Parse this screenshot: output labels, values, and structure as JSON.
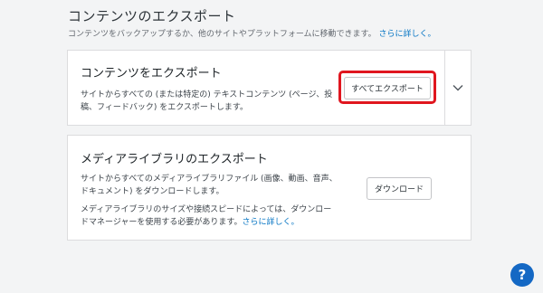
{
  "header": {
    "title": "コンテンツのエクスポート",
    "description": "コンテンツをバックアップするか、他のサイトやプラットフォームに移動できます。",
    "learn_more": "さらに詳しく。"
  },
  "export_card": {
    "title": "コンテンツをエクスポート",
    "description_line1": "サイトからすべての (または特定の) テキストコンテンツ (ページ、投",
    "description_line2": "稿、フィードバック) をエクスポートします。",
    "button_label": "すべてエクスポート",
    "toggle_icon": "chevron-down-icon"
  },
  "media_card": {
    "title": "メディアライブラリのエクスポート",
    "description_line1": "サイトからすべてのメディアライブラリファイル (画像、動画、音声、",
    "description_line2": "ドキュメント) をダウンロードします。",
    "note_line1": "メディアライブラリのサイズや接続スピードによっては、ダウンロー",
    "note_line2": "ドマネージャーを使用する必要があります。",
    "learn_more": "さらに詳しく。",
    "button_label": "ダウンロード"
  },
  "help": {
    "label": "?",
    "icon": "help-icon"
  },
  "colors": {
    "link": "#0675c4",
    "highlight": "#e0161f",
    "help_button": "#1468c4",
    "background": "#f3f4f5"
  }
}
